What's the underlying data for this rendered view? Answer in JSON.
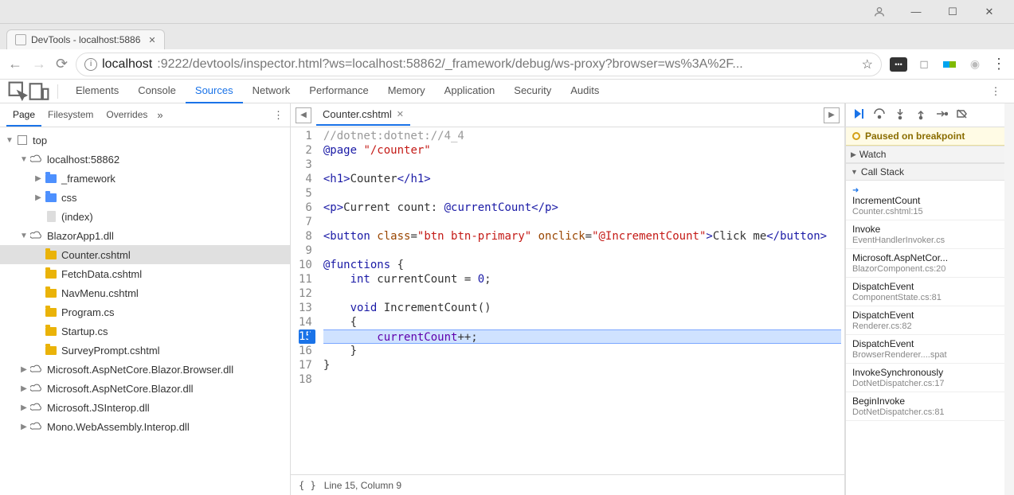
{
  "window": {
    "title": "DevTools - localhost:5886"
  },
  "address": {
    "host": "localhost",
    "path": ":9222/devtools/inspector.html?ws=localhost:58862/_framework/debug/ws-proxy?browser=ws%3A%2F..."
  },
  "devtools_tabs": [
    "Elements",
    "Console",
    "Sources",
    "Network",
    "Performance",
    "Memory",
    "Application",
    "Security",
    "Audits"
  ],
  "devtools_active_tab": "Sources",
  "sources_tabs": [
    "Page",
    "Filesystem",
    "Overrides"
  ],
  "sources_active_tab": "Page",
  "tree": [
    {
      "depth": 0,
      "arrow": "▼",
      "icon": "frame",
      "label": "top"
    },
    {
      "depth": 1,
      "arrow": "▼",
      "icon": "cloud",
      "label": "localhost:58862"
    },
    {
      "depth": 2,
      "arrow": "▶",
      "icon": "folder",
      "label": "_framework"
    },
    {
      "depth": 2,
      "arrow": "▶",
      "icon": "folder",
      "label": "css"
    },
    {
      "depth": 2,
      "arrow": "",
      "icon": "file",
      "label": "(index)"
    },
    {
      "depth": 1,
      "arrow": "▼",
      "icon": "cloud",
      "label": "BlazorApp1.dll"
    },
    {
      "depth": 2,
      "arrow": "",
      "icon": "yfolder",
      "label": "Counter.cshtml",
      "selected": true
    },
    {
      "depth": 2,
      "arrow": "",
      "icon": "yfolder",
      "label": "FetchData.cshtml"
    },
    {
      "depth": 2,
      "arrow": "",
      "icon": "yfolder",
      "label": "NavMenu.cshtml"
    },
    {
      "depth": 2,
      "arrow": "",
      "icon": "yfolder",
      "label": "Program.cs"
    },
    {
      "depth": 2,
      "arrow": "",
      "icon": "yfolder",
      "label": "Startup.cs"
    },
    {
      "depth": 2,
      "arrow": "",
      "icon": "yfolder",
      "label": "SurveyPrompt.cshtml"
    },
    {
      "depth": 1,
      "arrow": "▶",
      "icon": "cloud",
      "label": "Microsoft.AspNetCore.Blazor.Browser.dll"
    },
    {
      "depth": 1,
      "arrow": "▶",
      "icon": "cloud",
      "label": "Microsoft.AspNetCore.Blazor.dll"
    },
    {
      "depth": 1,
      "arrow": "▶",
      "icon": "cloud",
      "label": "Microsoft.JSInterop.dll"
    },
    {
      "depth": 1,
      "arrow": "▶",
      "icon": "cloud",
      "label": "Mono.WebAssembly.Interop.dll"
    }
  ],
  "editor": {
    "file_name": "Counter.cshtml",
    "breakpoint_line": 15,
    "status": "Line 15, Column 9",
    "lines": [
      {
        "n": 1,
        "tokens": [
          [
            "comment",
            "//dotnet:dotnet://4_4"
          ]
        ]
      },
      {
        "n": 2,
        "tokens": [
          [
            "kw",
            "@page"
          ],
          [
            "",
            " "
          ],
          [
            "str",
            "\"/counter\""
          ]
        ]
      },
      {
        "n": 3,
        "tokens": []
      },
      {
        "n": 4,
        "tokens": [
          [
            "tag",
            "<h1>"
          ],
          [
            "",
            "Counter"
          ],
          [
            "tag",
            "</h1>"
          ]
        ]
      },
      {
        "n": 5,
        "tokens": []
      },
      {
        "n": 6,
        "tokens": [
          [
            "tag",
            "<p>"
          ],
          [
            "",
            "Current count: "
          ],
          [
            "kw",
            "@currentCount"
          ],
          [
            "tag",
            "</p>"
          ]
        ]
      },
      {
        "n": 7,
        "tokens": []
      },
      {
        "n": 8,
        "tokens": [
          [
            "tag",
            "<button "
          ],
          [
            "attr",
            "class"
          ],
          [
            "",
            "="
          ],
          [
            "str",
            "\"btn btn-primary\""
          ],
          [
            "",
            " "
          ],
          [
            "attr",
            "onclick"
          ],
          [
            "",
            "="
          ],
          [
            "str",
            "\"@IncrementCount\""
          ],
          [
            "tag",
            ">"
          ],
          [
            "",
            "Click me"
          ],
          [
            "tag",
            "</button>"
          ]
        ]
      },
      {
        "n": 9,
        "tokens": []
      },
      {
        "n": 10,
        "tokens": [
          [
            "kw",
            "@functions "
          ],
          [
            "",
            "{"
          ]
        ]
      },
      {
        "n": 11,
        "tokens": [
          [
            "",
            "    "
          ],
          [
            "kw",
            "int"
          ],
          [
            "",
            " currentCount = "
          ],
          [
            "num",
            "0"
          ],
          [
            "",
            ";"
          ]
        ]
      },
      {
        "n": 12,
        "tokens": []
      },
      {
        "n": 13,
        "tokens": [
          [
            "",
            "    "
          ],
          [
            "kw",
            "void"
          ],
          [
            "",
            " IncrementCount()"
          ]
        ]
      },
      {
        "n": 14,
        "tokens": [
          [
            "",
            "    {"
          ]
        ]
      },
      {
        "n": 15,
        "tokens": [
          [
            "",
            "        "
          ],
          [
            "var",
            "currentCount"
          ],
          [
            "",
            "++;"
          ]
        ],
        "hl": true
      },
      {
        "n": 16,
        "tokens": [
          [
            "",
            "    }"
          ]
        ]
      },
      {
        "n": 17,
        "tokens": [
          [
            "",
            "}"
          ]
        ]
      },
      {
        "n": 18,
        "tokens": []
      }
    ]
  },
  "debugger": {
    "banner": "Paused on breakpoint",
    "watch_label": "Watch",
    "callstack_label": "Call Stack",
    "frames": [
      {
        "fn": "IncrementCount",
        "loc": "Counter.cshtml:15",
        "current": true
      },
      {
        "fn": "Invoke",
        "loc": "EventHandlerInvoker.cs"
      },
      {
        "fn": "Microsoft.AspNetCor...",
        "loc": "BlazorComponent.cs:20"
      },
      {
        "fn": "DispatchEvent",
        "loc": "ComponentState.cs:81"
      },
      {
        "fn": "DispatchEvent",
        "loc": "Renderer.cs:82"
      },
      {
        "fn": "DispatchEvent",
        "loc": "BrowserRenderer....spat"
      },
      {
        "fn": "InvokeSynchronously",
        "loc": "DotNetDispatcher.cs:17"
      },
      {
        "fn": "BeginInvoke",
        "loc": "DotNetDispatcher.cs:81"
      }
    ]
  }
}
